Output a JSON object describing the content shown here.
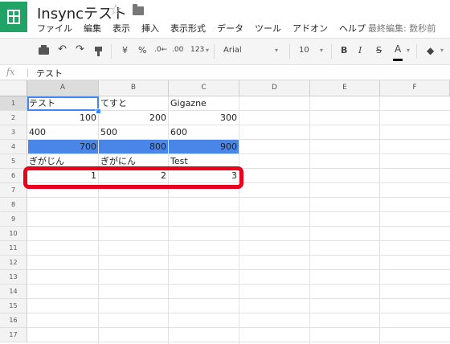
{
  "app": {
    "doc_title": "Insyncテスト",
    "star_glyph": "☆",
    "last_edit": "最終編集: 数秒前",
    "menu": [
      "ファイル",
      "編集",
      "表示",
      "挿入",
      "表示形式",
      "データ",
      "ツール",
      "アドオン",
      "ヘルプ"
    ]
  },
  "toolbar": {
    "currency": "¥",
    "percent": "%",
    "dec_decrease": ".0←",
    "dec_increase": ".00",
    "more_formats": "123",
    "font": "Arial",
    "font_size": "10",
    "bold": "B",
    "italic": "I",
    "strike": "S",
    "text_color": "A",
    "dropdown": "▾",
    "text_color_hex": "#000000",
    "fill_color_hex": "#4a86e8"
  },
  "formula": {
    "fx": "fx",
    "content": "テスト"
  },
  "sheet": {
    "columns": [
      "A",
      "B",
      "C",
      "D",
      "E",
      "F"
    ],
    "rows": [
      "1",
      "2",
      "3",
      "4",
      "5",
      "6",
      "7",
      "8",
      "9",
      "10",
      "11",
      "12",
      "13",
      "14",
      "15",
      "16",
      "17"
    ],
    "selected_cell": "A1",
    "row4_fill": "#4a86e8",
    "highlight_color": "#e8001c",
    "cells": {
      "A1": "テスト",
      "B1": "てすと",
      "C1": "Gigazne",
      "A2": "100",
      "B2": "200",
      "C2": "300",
      "A3": "400",
      "B3": "500",
      "C3": "600",
      "A4": "700",
      "B4": "800",
      "C4": "900",
      "A5": "ぎがじん",
      "B5": "ぎがにん",
      "C5": "Test",
      "A6": "1",
      "B6": "2",
      "C6": "3"
    }
  }
}
